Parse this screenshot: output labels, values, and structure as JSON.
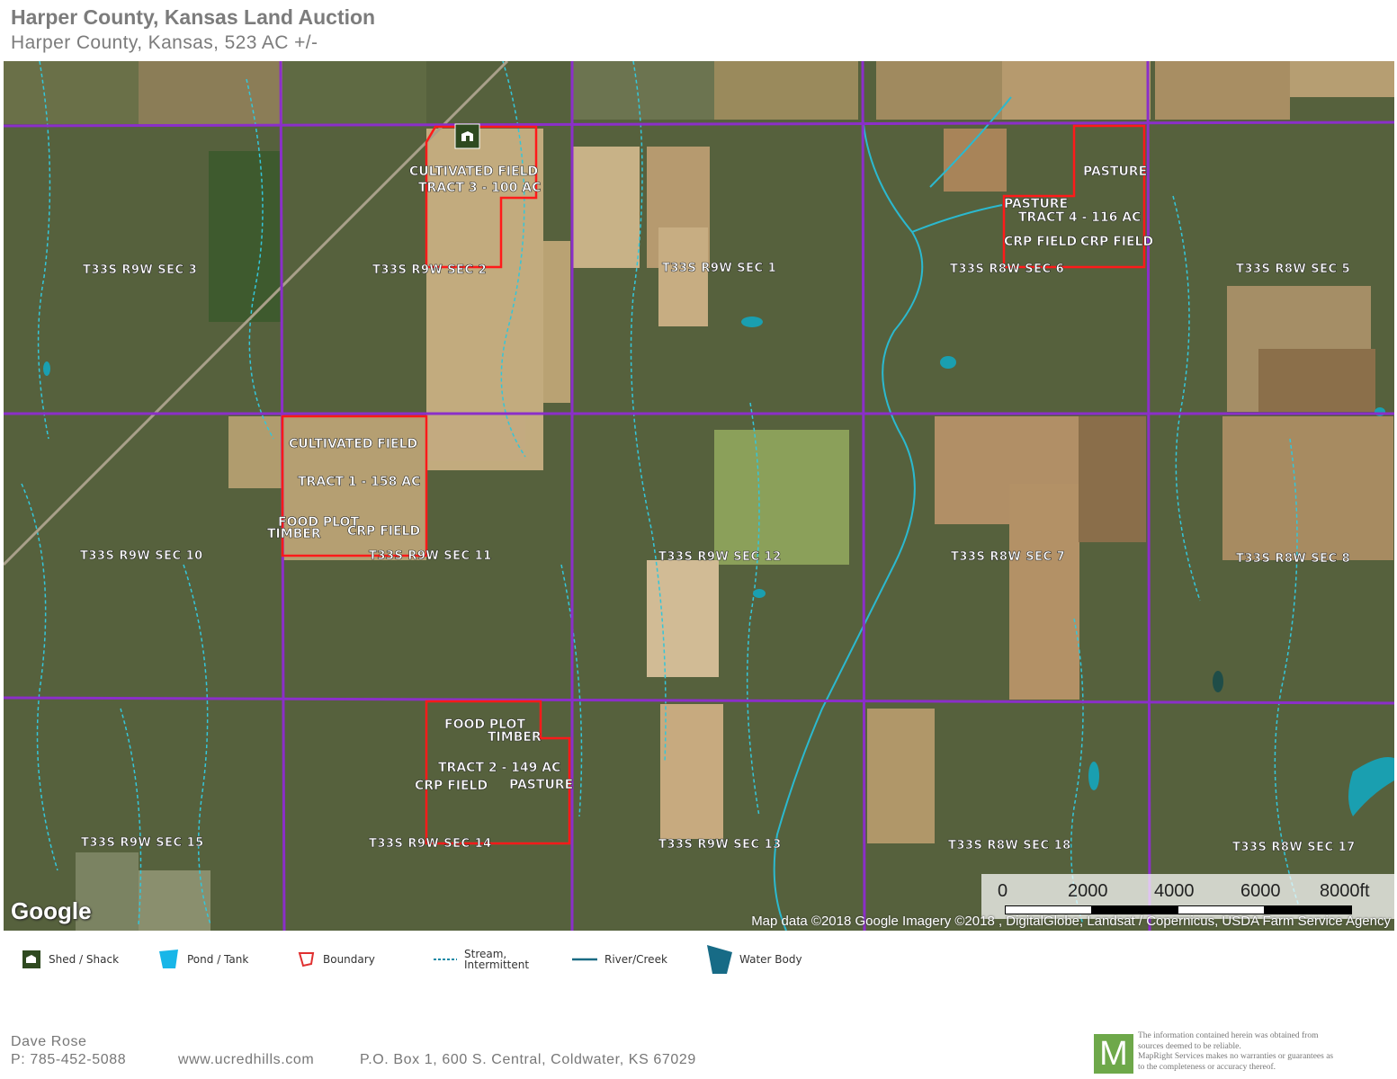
{
  "header": {
    "title": "Harper County, Kansas Land Auction",
    "subtitle": "Harper County, Kansas, 523 AC +/-"
  },
  "map": {
    "sections": [
      "T33S R9W SEC 3",
      "T33S R9W SEC 2",
      "T33S R9W SEC 1",
      "T33S R8W SEC 6",
      "T33S R8W SEC 5",
      "T33S R9W SEC 10",
      "T33S R9W SEC 11",
      "T33S R9W SEC 12",
      "T33S R8W SEC 7",
      "T33S R8W SEC 8",
      "T33S R9W SEC 15",
      "T33S R9W SEC 14",
      "T33S R9W SEC 13",
      "T33S R8W SEC 18",
      "T33S R8W SEC 17"
    ],
    "tract3": {
      "l1": "CULTIVATED FIELD",
      "l2": "TRACT 3 - 100 AC"
    },
    "tract4": {
      "l1": "PASTURE",
      "l2": "PASTURE",
      "l3": "TRACT 4 - 116 AC",
      "l4": "CRP FIELD",
      "l5": "CRP FIELD"
    },
    "tract1": {
      "l1": "CULTIVATED FIELD",
      "l2": "TRACT 1 - 158 AC",
      "l3": "FOOD PLOT",
      "l4": "TIMBER",
      "l5": "CRP FIELD"
    },
    "tract2": {
      "l1": "FOOD PLOT",
      "l2": "TIMBER",
      "l3": "TRACT 2 - 149 AC",
      "l4": "CRP FIELD",
      "l5": "PASTURE"
    },
    "google_logo": "Google",
    "credit": "Map data ©2018 Google  Imagery ©2018 , DigitalGlobe, Landsat / Copernicus, USDA Farm Service Agency",
    "scale": {
      "t0": "0",
      "t1": "2000",
      "t2": "4000",
      "t3": "6000",
      "t4": "8000ft"
    }
  },
  "legend": {
    "shed": "Shed / Shack",
    "pond": "Pond / Tank",
    "boundary": "Boundary",
    "stream_1": "Stream,",
    "stream_2": "Intermittent",
    "river": "River/Creek",
    "water": "Water Body"
  },
  "footer": {
    "name": "Dave Rose",
    "phone": "P: 785-452-5088",
    "website": "www.ucredhills.com",
    "address": "P.O. Box 1, 600 S. Central, Coldwater, KS 67029",
    "logo_letter": "M",
    "disclaimer_1": "The information contained herein was obtained from",
    "disclaimer_2": "sources deemed to be reliable.",
    "disclaimer_3": "MapRight Services makes no warranties or guarantees as",
    "disclaimer_4": "to the completeness or accuracy thereof."
  },
  "colors": {
    "section_line": "#8b2fc9",
    "boundary": "#ff1a1a",
    "stream": "#34c6d9",
    "water": "#1a9fb0"
  }
}
